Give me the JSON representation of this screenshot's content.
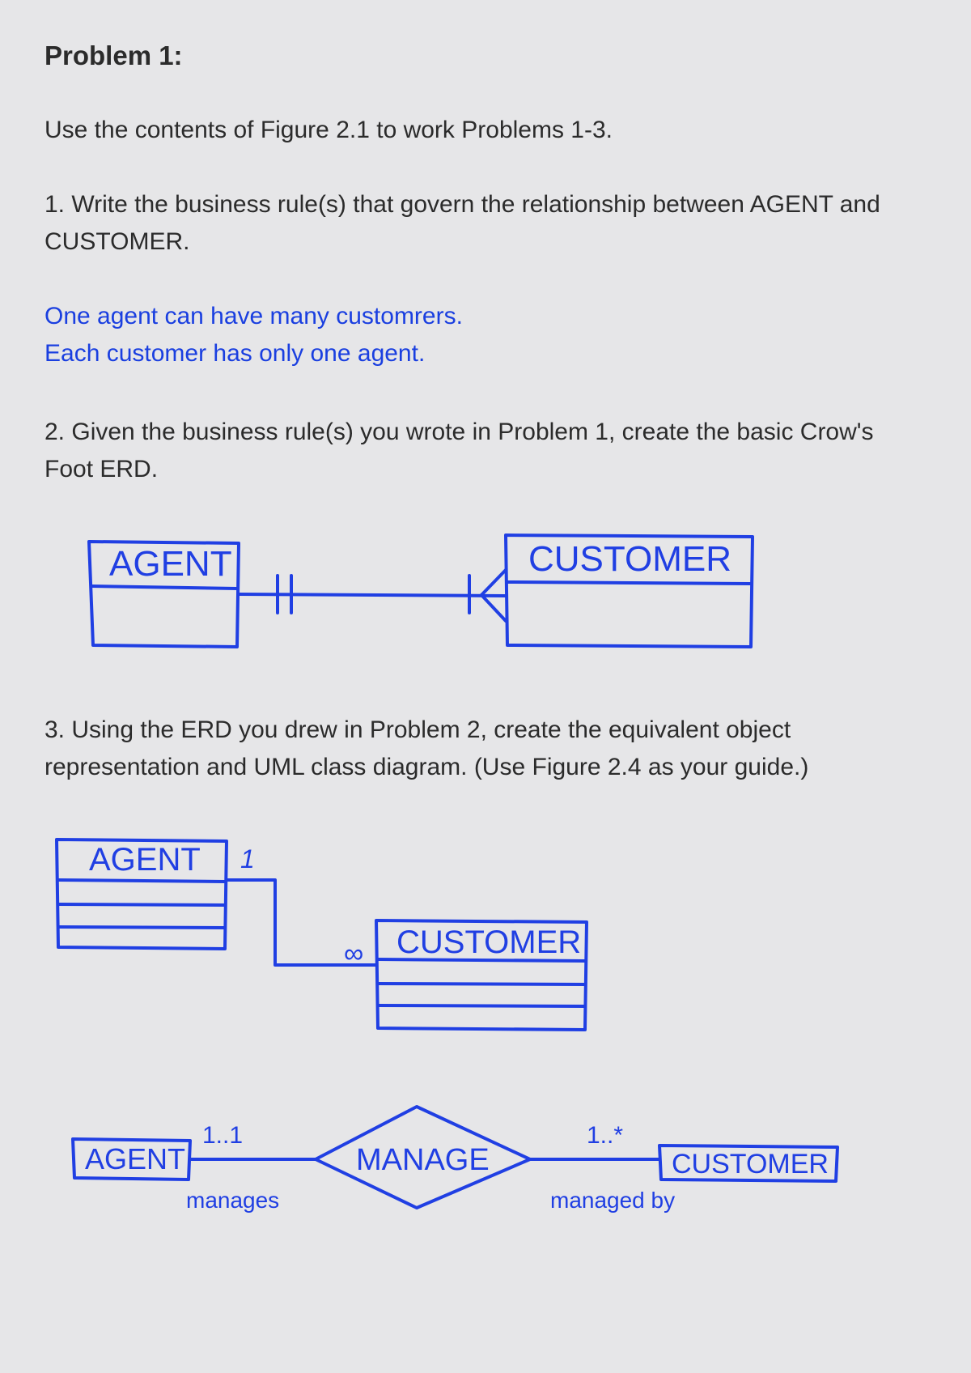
{
  "title": "Problem 1:",
  "intro": "Use the contents of Figure 2.1 to work Problems 1-3.",
  "q1": "1. Write the business rule(s) that govern the relationship between AGENT and CUSTOMER.",
  "a1_line1": "One agent can have many customrers.",
  "a1_line2": "Each customer has only one agent.",
  "q2": "2. Given the business rule(s) you wrote in Problem 1, create the basic Crow's Foot ERD.",
  "q3": "3. Using the ERD you drew in Problem 2, create the equivalent object representation and UML class diagram. (Use Figure 2.4 as your guide.)",
  "diagram": {
    "agent": "AGENT",
    "customer": "CUSTOMER",
    "manage": "MANAGE",
    "one": "1",
    "inf": "∞",
    "one_one": "1..1",
    "one_star": "1..*",
    "manages": "manages",
    "managed_by": "managed by"
  }
}
